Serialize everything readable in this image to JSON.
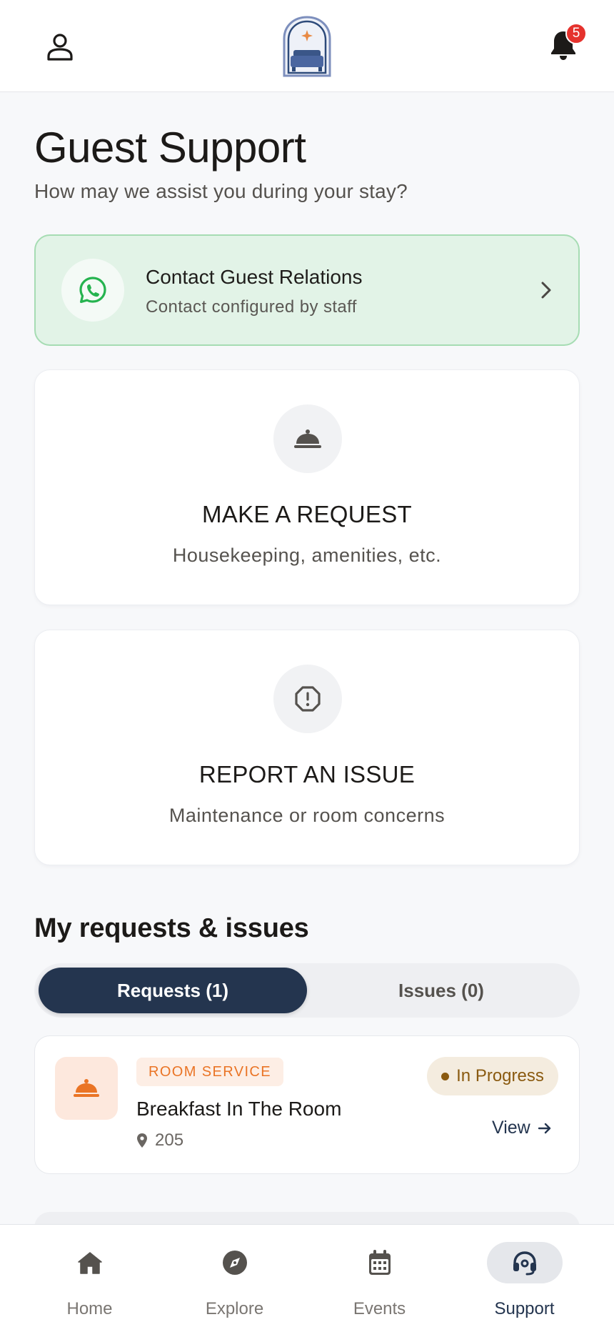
{
  "header": {
    "notification_count": "5",
    "icons": {
      "profile": "user-icon",
      "logo": "hotel-bed-logo",
      "bell": "bell-icon"
    }
  },
  "page": {
    "title": "Guest Support",
    "subtitle": "How may we assist you during your stay?"
  },
  "contact": {
    "title": "Contact Guest Relations",
    "subtitle": "Contact configured by staff",
    "icon": "whatsapp-icon"
  },
  "actions": {
    "request": {
      "title": "MAKE A REQUEST",
      "subtitle": "Housekeeping, amenities, etc.",
      "icon": "service-bell-icon"
    },
    "issue": {
      "title": "REPORT AN ISSUE",
      "subtitle": "Maintenance or room concerns",
      "icon": "alert-octagon-icon"
    }
  },
  "list": {
    "title": "My requests & issues",
    "tabs": {
      "requests": "Requests (1)",
      "issues": "Issues (0)"
    },
    "items": [
      {
        "category": "ROOM SERVICE",
        "title": "Breakfast In The Room",
        "location": "205",
        "status": "In Progress",
        "action": "View"
      }
    ]
  },
  "nav": {
    "home": "Home",
    "explore": "Explore",
    "events": "Events",
    "support": "Support",
    "active": "support"
  },
  "colors": {
    "primary_navy": "#24354f",
    "whatsapp_green": "#25b34f",
    "accent_orange": "#ea7425",
    "status_brown": "#8a5a10",
    "badge_red": "#e5322d"
  }
}
